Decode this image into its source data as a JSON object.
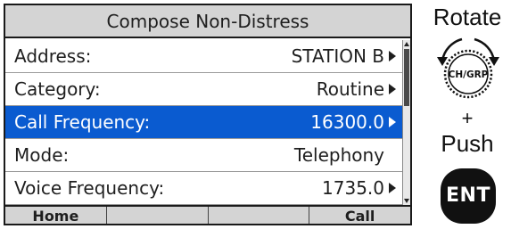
{
  "screen": {
    "title": "Compose Non-Distress",
    "rows": [
      {
        "label": "Address:",
        "value": "STATION B",
        "has_arrow": true,
        "selected": false
      },
      {
        "label": "Category:",
        "value": "Routine",
        "has_arrow": true,
        "selected": false
      },
      {
        "label": "Call Frequency:",
        "value": "16300.0",
        "has_arrow": true,
        "selected": true
      },
      {
        "label": "Mode:",
        "value": "Telephony",
        "has_arrow": false,
        "selected": false
      },
      {
        "label": "Voice Frequency:",
        "value": "1735.0",
        "has_arrow": true,
        "selected": false
      }
    ],
    "softkeys": [
      "Home",
      "",
      "",
      "Call"
    ],
    "scrollbar": {
      "up_icon": "scroll-up-arrow",
      "down_icon": "scroll-down-arrow"
    }
  },
  "controls": {
    "rotate_label": "Rotate",
    "knob_label": "CH/GRP",
    "plus_label": "+",
    "push_label": "Push",
    "ent_label": "ENT"
  },
  "colors": {
    "selected_row": "#0a5bd0",
    "title_bar": "#d4d4d4",
    "softkey_bar": "#d4d4d4",
    "ent_key": "#111111"
  }
}
